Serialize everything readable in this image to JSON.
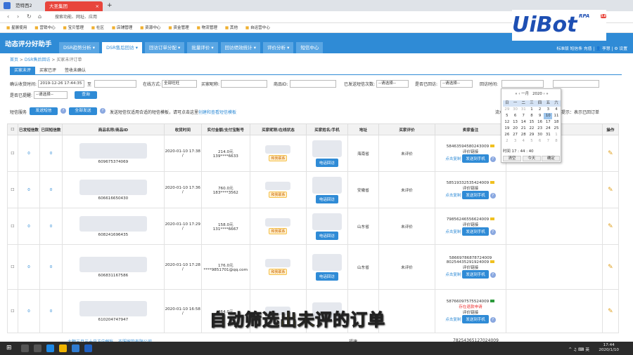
{
  "browser": {
    "tab1": "范特西2",
    "tab2": "大圣集团",
    "tab2_close": "×",
    "new_tab": "+",
    "url": "搜索功能、网址、应用",
    "bookmarks": [
      "星展使用",
      "营销中心",
      "宝贝管理",
      "社区",
      "店铺管理",
      "资源中心",
      "资金管理",
      "物流管理",
      "其他",
      "自运营中心"
    ]
  },
  "logo": {
    "text": "UiBot",
    "badge": "RPA",
    "version": "5.0"
  },
  "app": {
    "title": "动态评分好助手",
    "nav": [
      "DSR趋势分析 ▾",
      "DSR售后回访 ▾",
      "回访订单分配 ▾",
      "批量评价 ▾",
      "回访绩效统计 ▾",
      "评价分析 ▾",
      "短信中心"
    ],
    "top_right": "标准版 短信条 充值 | 👤 李慧 | ⚙ 设置"
  },
  "breadcrumb": {
    "home": "首页",
    "parent": "DSR售后回访",
    "current": "买家未评订单"
  },
  "subtabs": [
    "买家未评",
    "买家已评",
    "签收未确认"
  ],
  "filters": {
    "confirm_time_label": "确认收货时间:",
    "confirm_time_value": "2019-12-26 17:44:35",
    "to": "至",
    "method_label": "在线方式:",
    "method_value": "全部旺旺",
    "buyer_label": "买家昵称:",
    "product_label": "商品ID:",
    "sms_label": "已发送短信次数:",
    "sms_value": "--请选择--",
    "visited_label": "是否已回访:",
    "visited_value": "--请选择--",
    "visit_time_label": "回访时间:",
    "remind_label": "是否已提醒:",
    "remind_value": "--请选择--",
    "query": "查询",
    "sms_service": "短信服务",
    "send_sms": "发送短信",
    "send_all": "全部发送",
    "sms_hint": "发送短信仅适用合适的短信模板，请可点击这里",
    "sms_hint_link": "创建和查看短信模板",
    "right_hint": "温馨提示：表示已回订单",
    "right_prefix": "流水"
  },
  "calendar": {
    "month": "一月",
    "year": "2020",
    "weekdays": [
      "日",
      "一",
      "二",
      "三",
      "四",
      "五",
      "六"
    ],
    "days": [
      "29",
      "30",
      "31",
      "1",
      "2",
      "3",
      "4",
      "5",
      "6",
      "7",
      "8",
      "9",
      "10",
      "11",
      "12",
      "13",
      "14",
      "15",
      "16",
      "17",
      "18",
      "19",
      "20",
      "21",
      "22",
      "23",
      "24",
      "25",
      "26",
      "27",
      "28",
      "29",
      "30",
      "31",
      "1",
      "2",
      "3",
      "4",
      "5",
      "6",
      "7",
      "8"
    ],
    "time_label": "时间",
    "hour": "17",
    "min": "44",
    "sec": "40",
    "clear": "清空",
    "today": "今天",
    "ok": "确定"
  },
  "table": {
    "headers": [
      "",
      "已发短信数",
      "已回短信数",
      "商品名称/商品ID",
      "收货时间",
      "实付金额/支付宝账号",
      "买家昵称/在线状态",
      "买家姓名/手机",
      "地址",
      "买家评价",
      "卖家备注",
      "",
      "操作"
    ],
    "phone_btn": "电话回访",
    "contact_tag": "和我联系",
    "copy_link": "点击复制",
    "send_phone": "发送到手机",
    "eval_link": "评价链接",
    "rows": [
      {
        "sent": "0",
        "replied": "0",
        "pid": "609675374069",
        "time": "2020-01-10 17:38",
        "amount": "214.0元",
        "account": "139****6633",
        "addr": "海南省",
        "eval": "未评价",
        "remark": [
          "58463594580243009"
        ],
        "red": ""
      },
      {
        "sent": "0",
        "replied": "0",
        "pid": "606616650430",
        "time": "2020-01-10 17:36",
        "amount": "760.0元",
        "account": "183****3562",
        "addr": "安徽省",
        "eval": "未评价",
        "remark": [
          "58519332535424009"
        ],
        "red": ""
      },
      {
        "sent": "0",
        "replied": "0",
        "pid": "608241696435",
        "time": "2020-01-10 17:29",
        "amount": "158.0元",
        "account": "131****6667",
        "addr": "山东省",
        "eval": "未评价",
        "remark": [
          "79856246556624009"
        ],
        "red": ""
      },
      {
        "sent": "0",
        "replied": "0",
        "pid": "606831167586",
        "time": "2020-01-10 17:28",
        "amount": "176.0元",
        "account": "****9851701@qq.com",
        "addr": "山东省",
        "eval": "未评价",
        "remark": [
          "58669786878724009",
          "80254435291924009"
        ],
        "red": ""
      },
      {
        "sent": "0",
        "replied": "0",
        "pid": "610204747947",
        "time": "2020-01-10 16:58",
        "amount": "264.0元",
        "account": "",
        "addr": "",
        "eval": "",
        "remark": [
          "58766097575524009"
        ],
        "red": "存在退款申请"
      }
    ],
    "partial_row_text": "大额三月三十日方向解私，衣服留款有限公司",
    "partial_remark": "78254365127024009",
    "partial_addr": "福建"
  },
  "overlay_caption": "自动筛选出未评的订单",
  "taskbar": {
    "time": "17:44",
    "date": "2020/1/10",
    "lang": "英"
  }
}
